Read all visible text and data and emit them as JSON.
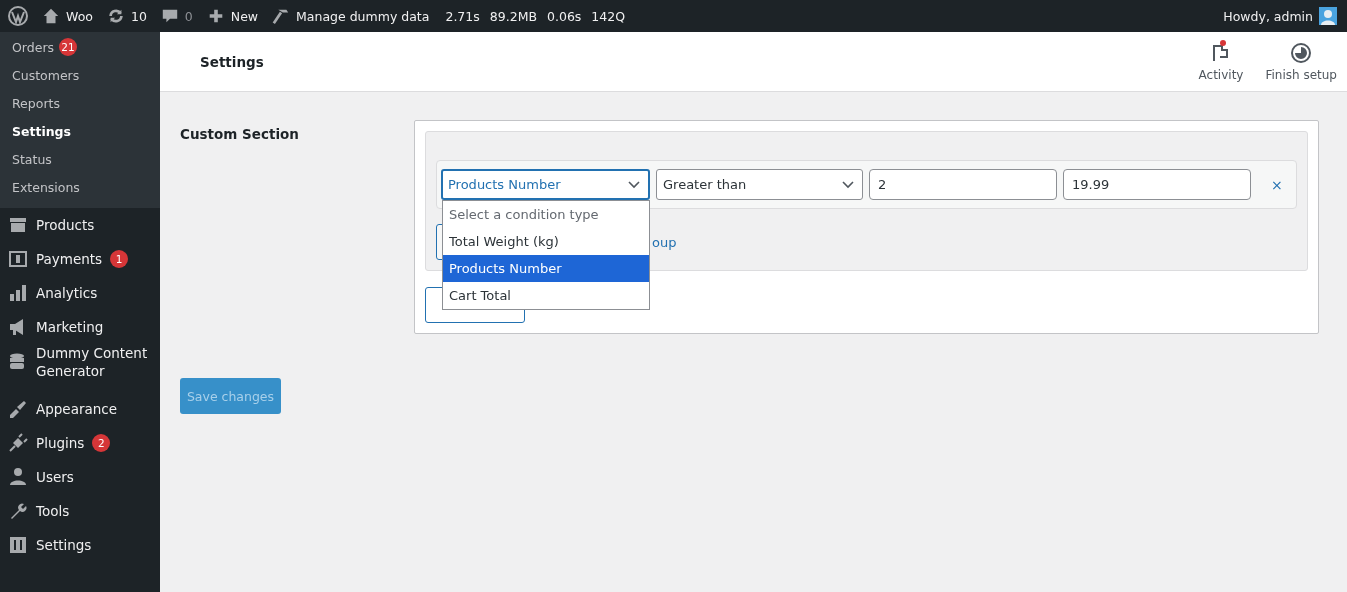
{
  "admin_bar": {
    "site": "Woo",
    "updates": "10",
    "comments": "0",
    "new": "New",
    "dummy": "Manage dummy data",
    "stats": [
      {
        "value": "2.71s"
      },
      {
        "value": "89.2MB"
      },
      {
        "value": "0.06s"
      },
      {
        "value": "142Q"
      }
    ],
    "greeting": "Howdy, admin"
  },
  "submenu": [
    {
      "label": "Orders",
      "badge": "21",
      "selected": false
    },
    {
      "label": "Customers",
      "selected": false
    },
    {
      "label": "Reports",
      "selected": false
    },
    {
      "label": "Settings",
      "selected": true
    },
    {
      "label": "Status",
      "selected": false
    },
    {
      "label": "Extensions",
      "selected": false
    }
  ],
  "menu": [
    {
      "label": "Products"
    },
    {
      "label": "Payments",
      "badge": "1"
    },
    {
      "label": "Analytics"
    },
    {
      "label": "Marketing"
    },
    {
      "label": "Dummy Content Generator"
    },
    {
      "label": "Appearance"
    },
    {
      "label": "Plugins",
      "badge": "2"
    },
    {
      "label": "Users"
    },
    {
      "label": "Tools"
    },
    {
      "label": "Settings"
    }
  ],
  "header": {
    "title": "Settings",
    "actions": [
      {
        "label": "Activity",
        "notify": true
      },
      {
        "label": "Finish setup",
        "notify": false
      }
    ]
  },
  "section": {
    "title": "Custom Section",
    "condition": {
      "type": "Products Number",
      "operator": "Greater than",
      "value_1": "2",
      "value_2": "19.99",
      "remove": "×"
    },
    "link_text": "oup",
    "dropdown": [
      {
        "label": "Select a condition type",
        "selected": false,
        "kind": "placeholder"
      },
      {
        "label": "Total Weight (kg)",
        "selected": false,
        "kind": "option"
      },
      {
        "label": "Products Number",
        "selected": true,
        "kind": "option"
      },
      {
        "label": "Cart Total",
        "selected": false,
        "kind": "option"
      }
    ]
  },
  "save_button": "Save changes"
}
